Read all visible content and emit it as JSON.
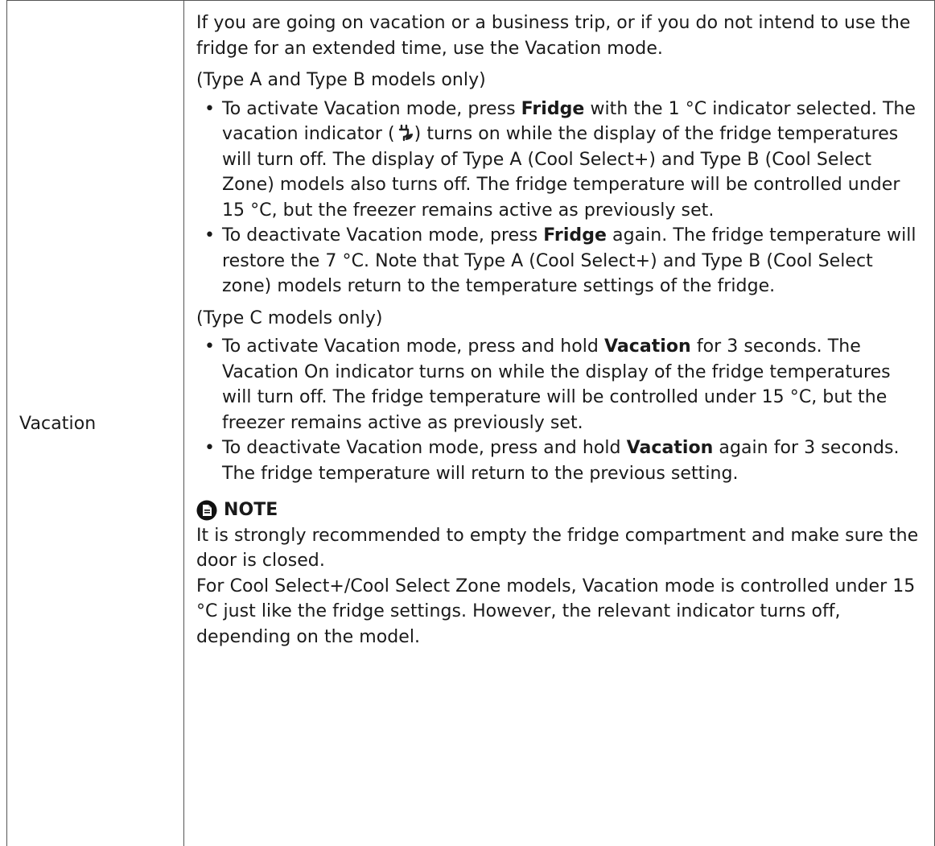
{
  "row_label": "Vacation",
  "intro": "If you are going on vacation or a business trip, or if you do not intend to use the fridge for an extended time, use the Vacation mode.",
  "section_ab": {
    "heading": "(Type A and Type B models only)",
    "bullet1": {
      "a": "To activate Vacation mode, press ",
      "b": "Fridge",
      "c": " with the 1 °C indicator selected. The vacation indicator (",
      "d": ") turns on while the display of the fridge temperatures will turn off. The display of Type A (Cool Select+) and Type B (Cool Select Zone) models also turns off. The fridge temperature will be controlled under 15 °C, but the freezer remains active as previously set."
    },
    "bullet2": {
      "a": "To deactivate Vacation mode, press ",
      "b": "Fridge",
      "c": " again. The fridge temperature will restore the 7 °C. Note that Type A (Cool Select+) and Type B (Cool Select zone) models return to the temperature settings of the fridge."
    }
  },
  "section_c": {
    "heading": "(Type C models only)",
    "bullet1": {
      "a": "To activate Vacation mode, press and hold ",
      "b": "Vacation",
      "c": " for 3 seconds. The Vacation On indicator turns on while the display of the fridge temperatures will turn off. The fridge temperature will be controlled under 15 °C, but the freezer remains active as previously set."
    },
    "bullet2": {
      "a": "To deactivate Vacation mode, press and hold ",
      "b": "Vacation",
      "c": " again for 3 seconds. The fridge temperature will return to the previous setting."
    }
  },
  "note": {
    "title": "NOTE",
    "para1": "It is strongly recommended to empty the fridge compartment and make sure the door is closed.",
    "para2": "For Cool Select+/Cool Select Zone models, Vacation mode is controlled under 15 °C just like the fridge settings. However, the relevant indicator turns off, depending on the model."
  },
  "icons": {
    "bullet": "•",
    "vacation_indicator": "plug-leaf-icon",
    "note": "note-document-icon"
  }
}
